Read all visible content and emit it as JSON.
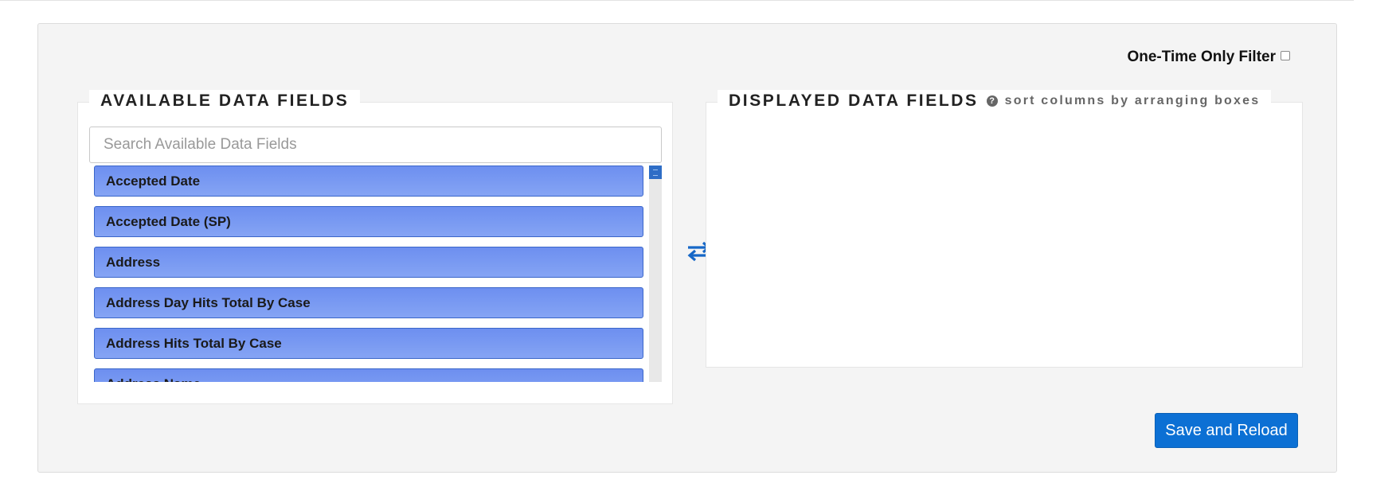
{
  "filter": {
    "one_time_label": "One-Time Only Filter",
    "one_time_checked": false
  },
  "available": {
    "title": "AVAILABLE DATA FIELDS",
    "search_placeholder": "Search Available Data Fields",
    "fields": [
      "Accepted Date",
      "Accepted Date (SP)",
      "Address",
      "Address Day Hits Total By Case",
      "Address Hits Total By Case",
      "Address Name"
    ]
  },
  "displayed": {
    "title": "DISPLAYED DATA FIELDS",
    "hint": "sort columns by arranging boxes",
    "hint_icon": "question-circle-icon",
    "fields": []
  },
  "swap_icon": "swap-arrows-icon",
  "actions": {
    "save_label": "Save and Reload"
  },
  "colors": {
    "accent": "#0c70d4",
    "field_fill": "#7a99f2",
    "field_border": "#3a66c9",
    "scroll_thumb": "#2e6dc6",
    "panel_bg": "#f4f4f4"
  }
}
